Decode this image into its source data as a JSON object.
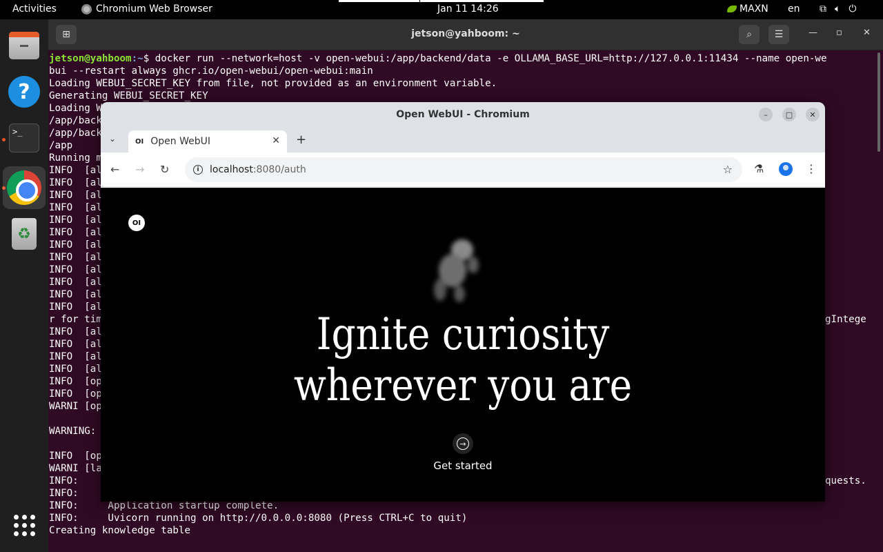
{
  "topbar": {
    "activities": "Activities",
    "app_name": "Chromium Web Browser",
    "clock": "Jan 11  14:26",
    "power_mode": "MAXN",
    "language": "en"
  },
  "terminal": {
    "title": "jetson@yahboom: ~",
    "prompt_user": "jetson@yahboom",
    "prompt_path": ":~",
    "command": "$ docker run --network=host -v open-webui:/app/backend/data -e OLLAMA_BASE_URL=http://127.0.0.1:11434 --name open-we",
    "lines": [
      "bui --restart always ghcr.io/open-webui/open-webui:main",
      "Loading WEBUI_SECRET_KEY from file, not provided as an environment variable.",
      "Generating WEBUI_SECRET_KEY",
      "Loading W",
      "/app/back",
      "/app/back",
      "/app",
      "Running m",
      "INFO  [al",
      "INFO  [al",
      "INFO  [al",
      "INFO  [al",
      "INFO  [al",
      "INFO  [al",
      "INFO  [al",
      "INFO  [al",
      "INFO  [al",
      "INFO  [al",
      "INFO  [al",
      "INFO  [al",
      "r for tim",
      "INFO  [al",
      "INFO  [al",
      "INFO  [al",
      "INFO  [al",
      "INFO  [op",
      "INFO  [op",
      "WARNI [op",
      "",
      "WARNING: ",
      "",
      "INFO  [op",
      "WARNI [la",
      "INFO:     ",
      "INFO:     Waiting for application startup.",
      "INFO:     Application startup complete.",
      "INFO:     Uvicorn running on http://0.0.0.0:8080 (Press CTRL+C to quit)",
      "Creating knowledge table"
    ],
    "right_fragment_1": "gIntege",
    "right_fragment_2": "quests."
  },
  "browser": {
    "window_title": "Open WebUI - Chromium",
    "tab_title": "Open WebUI",
    "tab_favicon": "OI",
    "url_host": "localhost",
    "url_path": ":8080/auth"
  },
  "page": {
    "logo_text": "OI",
    "headline_line1": "Ignite curiosity",
    "headline_line2": "wherever you are",
    "cta_label": "Get started"
  }
}
